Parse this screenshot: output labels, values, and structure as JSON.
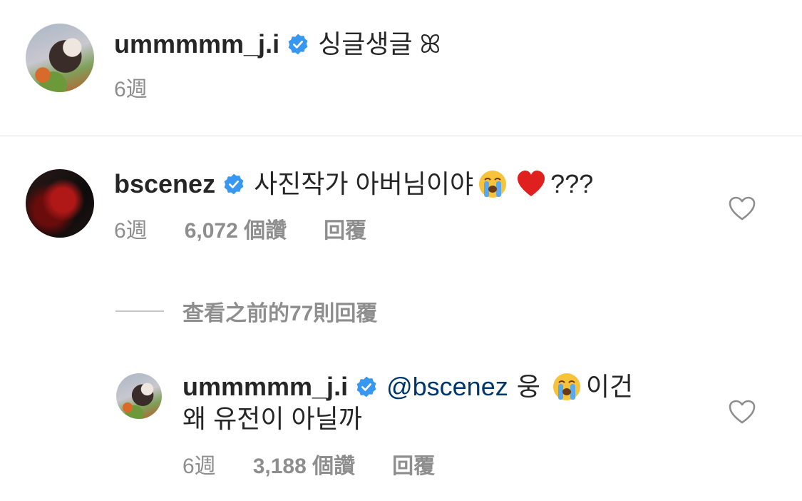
{
  "caption": {
    "username": "ummmmm_j.i",
    "text": "싱글생글 ꕤ",
    "time": "6週"
  },
  "comment1": {
    "username": "bscenez",
    "text": "사진작가 아버님이야",
    "trailing": "???",
    "time": "6週",
    "likes": "6,072 個讚",
    "reply_label": "回覆"
  },
  "view_previous": "查看之前的77則回覆",
  "reply1": {
    "username": "ummmmm_j.i",
    "mention": "@bscenez",
    "text_a": "웅",
    "text_b": "이건",
    "line2": "왜 유전이 아닐까",
    "time": "6週",
    "likes": "3,188 個讚",
    "reply_label": "回覆"
  },
  "colors": {
    "verified_blue": "#3897f0",
    "mention_blue": "#00376b",
    "meta_gray": "#8e8e8e",
    "heart_red": "#e0201f"
  },
  "icons": [
    "verified-badge-icon",
    "crying-face-emoji",
    "red-heart-emoji",
    "like-heart-icon"
  ]
}
